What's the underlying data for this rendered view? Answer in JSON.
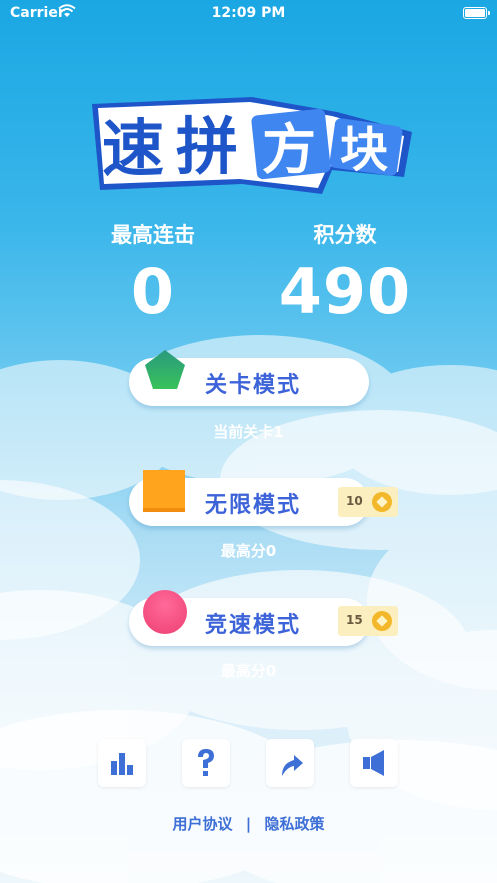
{
  "status_bar": {
    "carrier": "Carrier",
    "time": "12:09 PM"
  },
  "logo": {
    "chars": [
      "速",
      "拼",
      "方",
      "块"
    ]
  },
  "stats": {
    "combo_label": "最高连击",
    "combo_value": "0",
    "score_label": "积分数",
    "score_value": "490"
  },
  "modes": [
    {
      "label": "关卡模式",
      "subtitle": "当前关卡1",
      "icon": "green-pentagon-icon",
      "color": "#2fb46a"
    },
    {
      "label": "无限模式",
      "subtitle": "最高分0",
      "icon": "orange-square-icon",
      "color": "#ffa41c",
      "cost": "10"
    },
    {
      "label": "竞速模式",
      "subtitle": "最高分0",
      "icon": "pink-circle-icon",
      "color": "#f24f82",
      "cost": "15"
    }
  ],
  "toolbar": {
    "icons": [
      "leaderboard-icon",
      "help-icon",
      "share-icon",
      "sound-icon"
    ],
    "accent": "#3d6fd6"
  },
  "footer": {
    "agreement": "用户协议",
    "separator": "|",
    "privacy": "隐私政策"
  }
}
